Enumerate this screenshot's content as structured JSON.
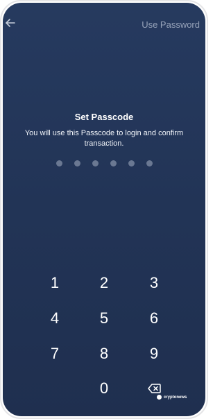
{
  "header": {
    "back_icon": "arrow-left-icon",
    "use_password_label": "Use Password"
  },
  "passcode": {
    "title": "Set Passcode",
    "subtitle": "You will use this Passcode to login and confirm transaction.",
    "digits_total": 6,
    "digits_entered": 0
  },
  "keypad": {
    "keys": [
      "1",
      "2",
      "3",
      "4",
      "5",
      "6",
      "7",
      "8",
      "9",
      "0"
    ],
    "delete_icon": "backspace-icon"
  },
  "watermark": {
    "text": "cryptonews"
  },
  "colors": {
    "background": "#223456",
    "dot": "#6a7892",
    "muted_text": "#97a3b9"
  }
}
